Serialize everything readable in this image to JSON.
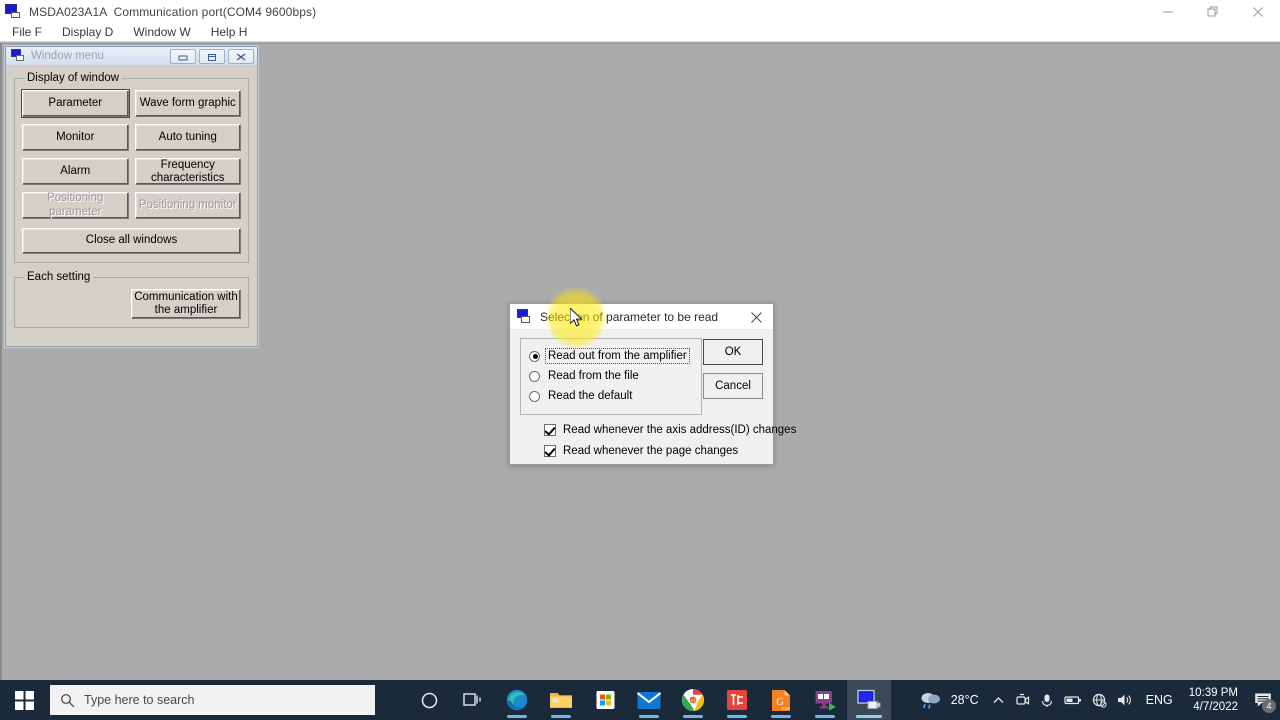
{
  "app": {
    "title": "MSDA023A1A  Communication port(COM4 9600bps)",
    "icon": "servo-amp-icon",
    "window_controls": [
      {
        "name": "minimize",
        "glyph": "minimize-icon"
      },
      {
        "name": "restore",
        "glyph": "restore-icon"
      },
      {
        "name": "close",
        "glyph": "close-icon"
      }
    ],
    "menubar": [
      {
        "label": "File F"
      },
      {
        "label": "Display D"
      },
      {
        "label": "Window W"
      },
      {
        "label": "Help H"
      }
    ]
  },
  "window_menu": {
    "title": "Window menu",
    "icon": "servo-amp-icon",
    "buttons": {
      "minimize": "minimize-icon",
      "restore": "restore-icon",
      "close": "close-icon"
    },
    "groups": [
      {
        "legend": "Display of window",
        "items": [
          {
            "label": "Parameter",
            "state": "default"
          },
          {
            "label": "Wave form graphic",
            "state": "enabled"
          },
          {
            "label": "Monitor",
            "state": "enabled"
          },
          {
            "label": "Auto tuning",
            "state": "enabled"
          },
          {
            "label": "Alarm",
            "state": "enabled"
          },
          {
            "label": "Frequency\ncharacteristics",
            "state": "enabled"
          },
          {
            "label": "Positioning parameter",
            "state": "disabled"
          },
          {
            "label": "Positioning monitor",
            "state": "disabled"
          },
          {
            "label": "Close all windows",
            "state": "enabled"
          }
        ]
      },
      {
        "legend": "Each setting",
        "items": [
          {
            "label": "Communication with\nthe amplifier",
            "state": "enabled"
          }
        ]
      }
    ]
  },
  "dialog": {
    "title": "Selection of parameter to be read",
    "icon": "servo-amp-icon",
    "close_glyph": "close-icon",
    "radios": [
      {
        "label": "Read out from the amplifier",
        "checked": true,
        "focused": true
      },
      {
        "label": "Read from the file",
        "checked": false,
        "focused": false
      },
      {
        "label": "Read the default",
        "checked": false,
        "focused": false
      }
    ],
    "buttons": [
      {
        "label": "OK",
        "style": "default"
      },
      {
        "label": "Cancel",
        "style": "normal"
      }
    ],
    "checkboxes": [
      {
        "label": "Read whenever the axis address(ID) changes",
        "checked": true
      },
      {
        "label": "Read whenever the page changes",
        "checked": true
      }
    ]
  },
  "taskbar": {
    "start": "windows-logo-icon",
    "search": {
      "placeholder": "Type here to search",
      "icon": "search-icon"
    },
    "items": [
      {
        "name": "cortana-icon",
        "running": false
      },
      {
        "name": "task-view-icon",
        "running": false
      },
      {
        "name": "microsoft-edge-icon",
        "running": true
      },
      {
        "name": "file-explorer-icon",
        "running": true
      },
      {
        "name": "microsoft-store-icon",
        "running": false
      },
      {
        "name": "mail-icon",
        "running": true
      },
      {
        "name": "google-chrome-icon",
        "running": true
      },
      {
        "name": "htc-app-icon",
        "running": true
      },
      {
        "name": "pdf-editor-icon",
        "running": true
      },
      {
        "name": "screen-recorder-icon",
        "running": true
      },
      {
        "name": "servo-amp-app-icon",
        "running": true,
        "active": true
      }
    ],
    "tray": {
      "weather": {
        "icon": "rain-cloud-icon",
        "temp": "28°C"
      },
      "overflow": "chevron-up-icon",
      "icons": [
        "webcam-icon",
        "microphone-icon",
        "battery-icon",
        "network-no-internet-icon",
        "volume-icon"
      ],
      "language": "ENG",
      "clock": {
        "time": "10:39 PM",
        "date": "4/7/2022"
      },
      "notifications": {
        "icon": "notification-icon",
        "count": "4"
      }
    }
  }
}
